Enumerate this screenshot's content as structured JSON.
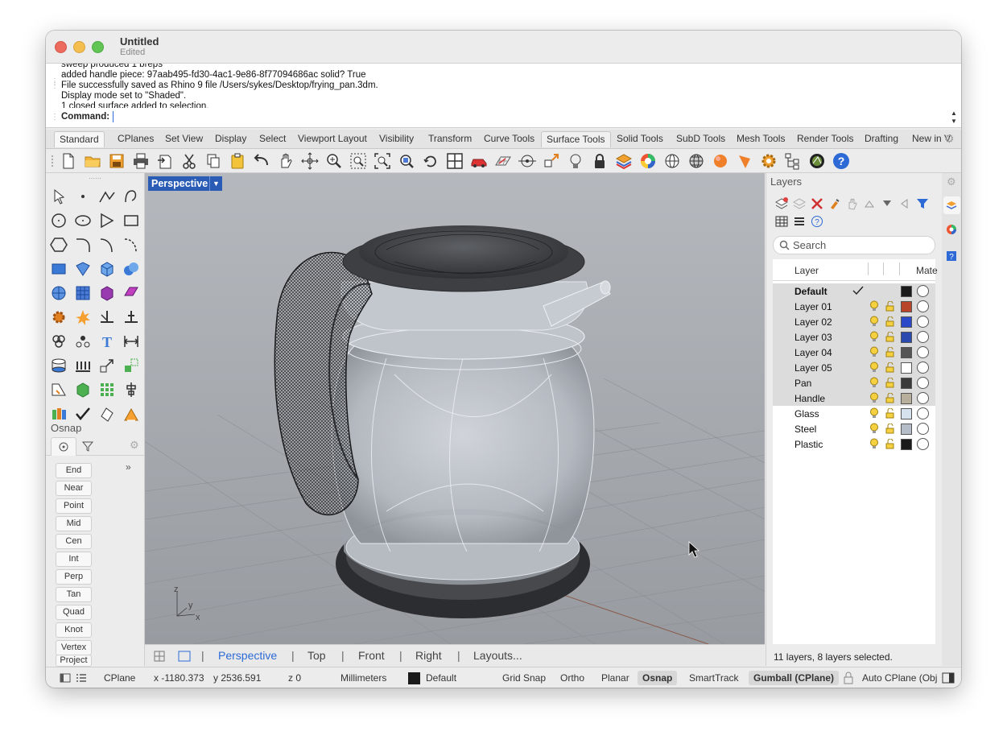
{
  "window": {
    "title": "Untitled",
    "subtitle": "Edited"
  },
  "history": {
    "lines": [
      "sweep produced 1 breps",
      "added handle piece: 97aab495-fd30-4ac1-9e86-8f77094686ac solid? True",
      "File successfully saved as Rhino 9 file /Users/sykes/Desktop/frying_pan.3dm.",
      "Display mode set to \"Shaded\".",
      "1 closed surface added to selection."
    ]
  },
  "command": {
    "label": "Command:",
    "value": ""
  },
  "tabs": [
    "Standard",
    "CPlanes",
    "Set View",
    "Display",
    "Select",
    "Viewport Layout",
    "Visibility",
    "Transform",
    "Curve Tools",
    "Surface Tools",
    "Solid Tools",
    "SubD Tools",
    "Mesh Tools",
    "Render Tools",
    "Drafting",
    "New in V"
  ],
  "active_tab": "Standard",
  "highlight_tab": "Surface Tools",
  "osnap": {
    "title": "Osnap",
    "items": [
      "End",
      "Near",
      "Point",
      "Mid",
      "Cen",
      "Int",
      "Perp",
      "Tan",
      "Quad",
      "Knot",
      "Vertex",
      "Project"
    ],
    "expand": "»"
  },
  "viewport": {
    "name": "Perspective",
    "axes": {
      "x": "x",
      "y": "y",
      "z": "z"
    }
  },
  "viewtabs": [
    "Perspective",
    "Top",
    "Front",
    "Right",
    "Layouts..."
  ],
  "layers": {
    "title": "Layers",
    "search_placeholder": "Search",
    "col_layer": "Layer",
    "col_material": "Mate",
    "rows": [
      {
        "name": "Default",
        "color": "#1b1b1b",
        "current": true,
        "selected": true
      },
      {
        "name": "Layer 01",
        "color": "#b8452a",
        "selected": true
      },
      {
        "name": "Layer 02",
        "color": "#2a48c8",
        "selected": true
      },
      {
        "name": "Layer 03",
        "color": "#2a4ab0",
        "selected": true
      },
      {
        "name": "Layer 04",
        "color": "#555555",
        "selected": true
      },
      {
        "name": "Layer 05",
        "color": "#ffffff",
        "selected": true
      },
      {
        "name": "Pan",
        "color": "#3a3a3a",
        "selected": true
      },
      {
        "name": "Handle",
        "color": "#b8ae9c",
        "selected": true
      },
      {
        "name": "Glass",
        "color": "#d6e2ee",
        "selected": false
      },
      {
        "name": "Steel",
        "color": "#b5bec8",
        "selected": false
      },
      {
        "name": "Plastic",
        "color": "#1b1b1b",
        "selected": false
      }
    ],
    "status": "11 layers, 8 layers selected."
  },
  "statusbar": {
    "cplane": "CPlane",
    "x": "x -1180.373",
    "y": "y 2536.591",
    "z": "z 0",
    "units": "Millimeters",
    "layer": "Default",
    "layer_color": "#1b1b1b",
    "grid_snap": "Grid Snap",
    "ortho": "Ortho",
    "planar": "Planar",
    "osnap": "Osnap",
    "smarttrack": "SmartTrack",
    "gumball": "Gumball (CPlane)",
    "autocplane": "Auto CPlane (Obj"
  },
  "colors": {
    "accent": "#2d6ad6",
    "viewport_tab": "#2a5bb5"
  }
}
